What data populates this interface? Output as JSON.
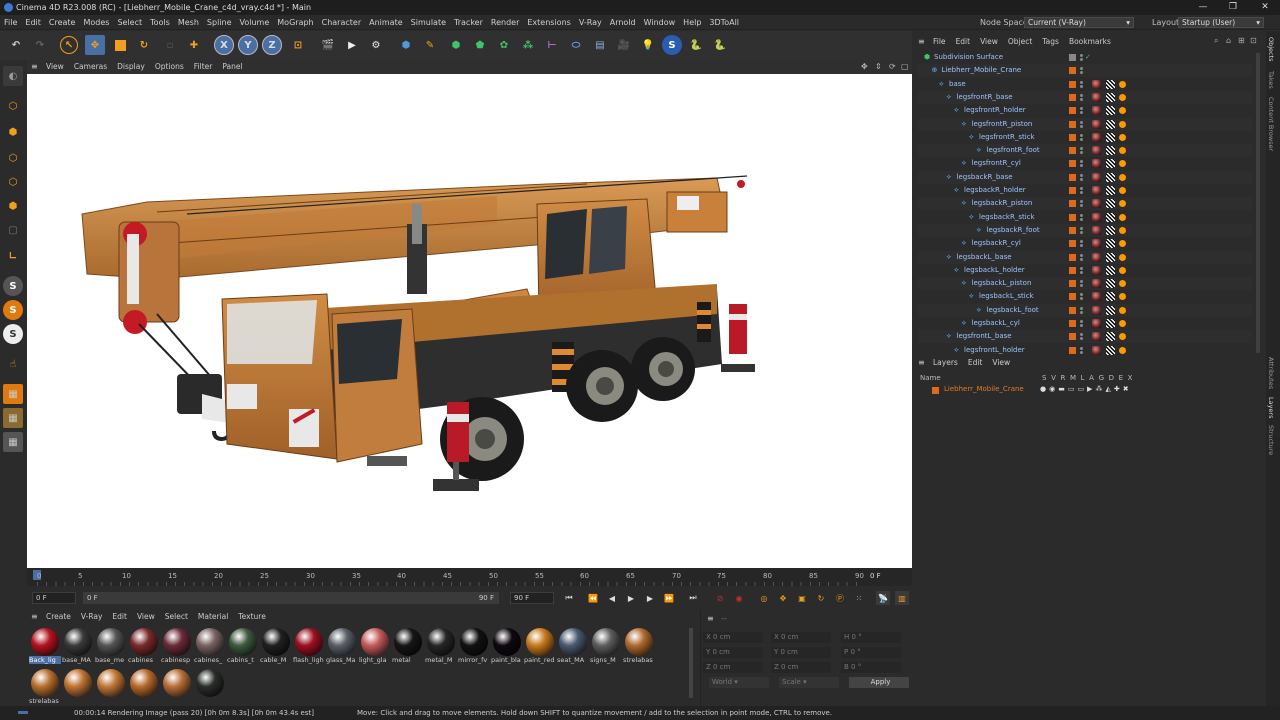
{
  "window": {
    "title": "Cinema 4D R23.008 (RC) - [Liebherr_Mobile_Crane_c4d_vray.c4d *] - Main",
    "controls": [
      "—",
      "❐",
      "✕"
    ]
  },
  "menubar": {
    "items": [
      "File",
      "Edit",
      "Create",
      "Modes",
      "Select",
      "Tools",
      "Mesh",
      "Spline",
      "Volume",
      "MoGraph",
      "Character",
      "Animate",
      "Simulate",
      "Tracker",
      "Render",
      "Extensions",
      "V-Ray",
      "Arnold",
      "Window",
      "Help",
      "3DToAll"
    ],
    "node_space_label": "Node Space:",
    "node_space_value": "Current (V-Ray)",
    "layout_label": "Layout:",
    "layout_value": "Startup (User)"
  },
  "viewport": {
    "menu": [
      "View",
      "Cameras",
      "Display",
      "Options",
      "Filter",
      "Panel"
    ]
  },
  "timeline": {
    "ticks": [
      "0",
      "5",
      "10",
      "15",
      "20",
      "25",
      "30",
      "35",
      "40",
      "45",
      "50",
      "55",
      "60",
      "65",
      "70",
      "75",
      "80",
      "85",
      "90"
    ],
    "current_frame": "0 F"
  },
  "playbar": {
    "start_field": "0 F",
    "range_start": "0 F",
    "range_end": "90 F",
    "end_field": "90 F"
  },
  "materials": {
    "menu": [
      "Create",
      "V-Ray",
      "Edit",
      "View",
      "Select",
      "Material",
      "Texture"
    ],
    "items": [
      {
        "name": "Back_lig",
        "color": "#b3141e"
      },
      {
        "name": "base_MA",
        "color": "#3a3a3a"
      },
      {
        "name": "base_me",
        "color": "#555555"
      },
      {
        "name": "cabines",
        "color": "#7a2a2a"
      },
      {
        "name": "cabinesp",
        "color": "#6a2b3a"
      },
      {
        "name": "cabines_",
        "color": "#7a6262"
      },
      {
        "name": "cabins_t",
        "color": "#3e5a3e"
      },
      {
        "name": "cable_M",
        "color": "#202020"
      },
      {
        "name": "flash_ligh",
        "color": "#9e1020"
      },
      {
        "name": "glass_Ma",
        "color": "#5a6068"
      },
      {
        "name": "light_gla",
        "color": "#c65a5a"
      },
      {
        "name": "metal",
        "color": "#161616"
      },
      {
        "name": "metal_M",
        "color": "#262626"
      },
      {
        "name": "mirror_fv",
        "color": "#121212"
      },
      {
        "name": "paint_bla",
        "color": "#100810"
      },
      {
        "name": "paint_red",
        "color": "#c97a1e"
      },
      {
        "name": "seat_MA",
        "color": "#4a5a70"
      },
      {
        "name": "signs_M",
        "color": "#5e5e5e"
      },
      {
        "name": "strelabas",
        "color": "#b06a30"
      },
      {
        "name": "strelabas",
        "color": "#b87030"
      },
      {
        "name": "",
        "color": "#c07434"
      },
      {
        "name": "",
        "color": "#c27838"
      },
      {
        "name": "",
        "color": "#b86a2e"
      },
      {
        "name": "",
        "color": "#b8703a"
      },
      {
        "name": "",
        "color": "#2a2e2a"
      }
    ]
  },
  "coordinates": {
    "x": "X  0 cm",
    "y": "Y  0 cm",
    "z": "Z  0 cm",
    "x2": "X  0 cm",
    "y2": "Y  0 cm",
    "z2": "Z  0 cm",
    "h": "H  0 °",
    "p": "P  0 °",
    "b": "B  0 °",
    "world": "World",
    "scale": "Scale",
    "apply": "Apply"
  },
  "status": {
    "left": "00:00:14 Rendering Image (pass 20) [0h  0m  8.3s] [0h  0m 43.4s est]",
    "right": "Move: Click and drag to move elements. Hold down SHIFT to quantize movement / add to the selection in point mode, CTRL to remove."
  },
  "objects": {
    "menu": [
      "File",
      "Edit",
      "View",
      "Object",
      "Tags",
      "Bookmarks"
    ],
    "rows": [
      {
        "name": "Subdivision Surface",
        "indent": 0
      },
      {
        "name": "Liebherr_Mobile_Crane",
        "indent": 1
      },
      {
        "name": "base",
        "indent": 2
      },
      {
        "name": "legsfrontR_base",
        "indent": 3
      },
      {
        "name": "legsfrontR_holder",
        "indent": 4
      },
      {
        "name": "legsfrontR_piston",
        "indent": 5
      },
      {
        "name": "legsfrontR_stick",
        "indent": 6
      },
      {
        "name": "legsfrontR_foot",
        "indent": 7
      },
      {
        "name": "legsfrontR_cyl",
        "indent": 5
      },
      {
        "name": "legsbackR_base",
        "indent": 3
      },
      {
        "name": "legsbackR_holder",
        "indent": 4
      },
      {
        "name": "legsbackR_piston",
        "indent": 5
      },
      {
        "name": "legsbackR_stick",
        "indent": 6
      },
      {
        "name": "legsbackR_foot",
        "indent": 7
      },
      {
        "name": "legsbackR_cyl",
        "indent": 5
      },
      {
        "name": "legsbackL_base",
        "indent": 3
      },
      {
        "name": "legsbackL_holder",
        "indent": 4
      },
      {
        "name": "legsbackL_piston",
        "indent": 5
      },
      {
        "name": "legsbackL_stick",
        "indent": 6
      },
      {
        "name": "legsbackL_foot",
        "indent": 7
      },
      {
        "name": "legsbackL_cyl",
        "indent": 5
      },
      {
        "name": "legsfrontL_base",
        "indent": 3
      },
      {
        "name": "legsfrontL_holder",
        "indent": 4
      }
    ]
  },
  "layers": {
    "menu": [
      "Layers",
      "Edit",
      "View"
    ],
    "name_header": "Name",
    "flag_headers": "S V R M L A G D E X",
    "rows": [
      {
        "name": "Liebherr_Mobile_Crane",
        "color": "#e06a1a"
      }
    ]
  },
  "side_tabs": {
    "top": [
      "Objects",
      "Takes",
      "Content Browser"
    ],
    "bottom": [
      "Attributes",
      "Layers",
      "Structure"
    ]
  },
  "colors": {
    "accent": "#4a6fa5",
    "object_text": "#9fc3ff",
    "layer_text": "#e07a2a",
    "crane_body": "#c8803a"
  }
}
